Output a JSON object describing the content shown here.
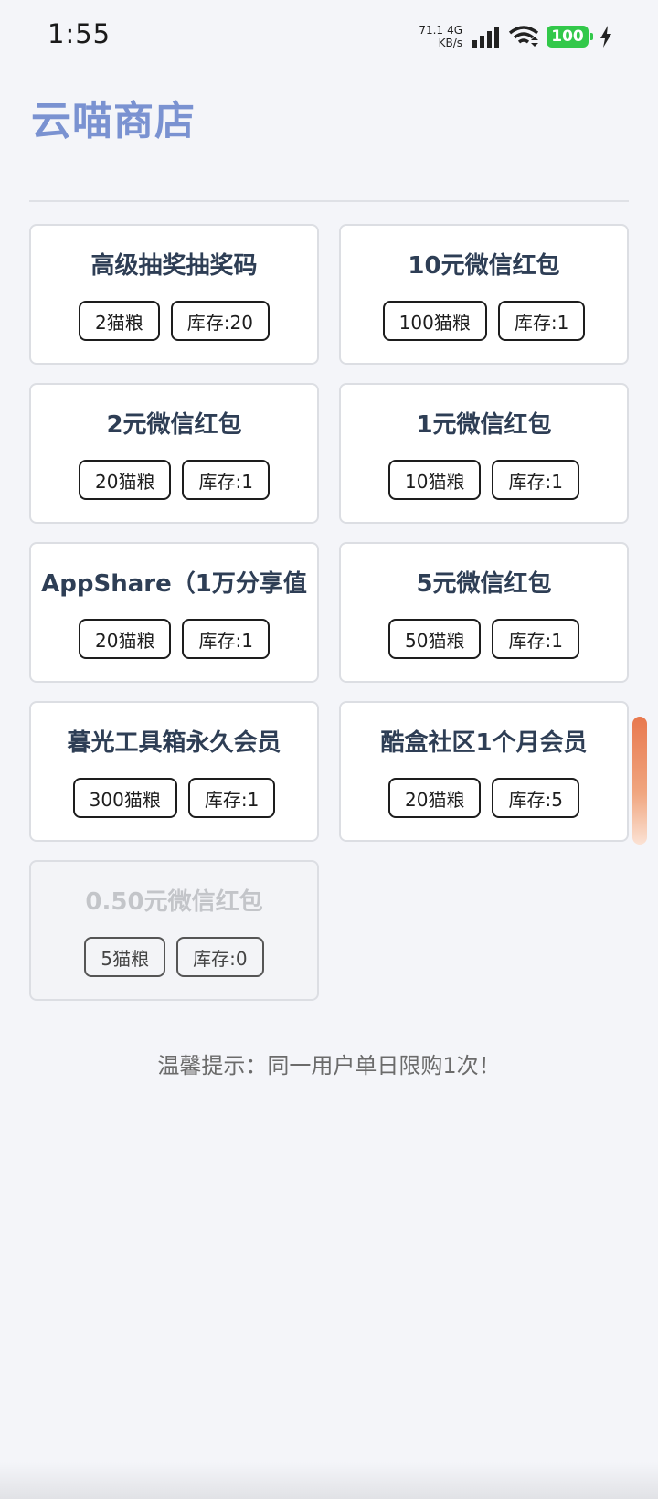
{
  "status_bar": {
    "time": "1:55",
    "net_speed_value": "71.1",
    "net_type": "4G",
    "net_speed_unit": "KB/s",
    "battery": "100",
    "icons": [
      "signal-icon",
      "wifi-icon",
      "battery-icon",
      "charging-icon"
    ]
  },
  "header": {
    "title": "云喵商店"
  },
  "items": [
    {
      "name": "高级抽奖抽奖码",
      "price": "2猫粮",
      "stock": "库存:20",
      "available": true
    },
    {
      "name": "10元微信红包",
      "price": "100猫粮",
      "stock": "库存:1",
      "available": true
    },
    {
      "name": "2元微信红包",
      "price": "20猫粮",
      "stock": "库存:1",
      "available": true
    },
    {
      "name": "1元微信红包",
      "price": "10猫粮",
      "stock": "库存:1",
      "available": true
    },
    {
      "name": "AppShare（1万分享值",
      "price": "20猫粮",
      "stock": "库存:1",
      "available": true
    },
    {
      "name": "5元微信红包",
      "price": "50猫粮",
      "stock": "库存:1",
      "available": true
    },
    {
      "name": "暮光工具箱永久会员",
      "price": "300猫粮",
      "stock": "库存:1",
      "available": true
    },
    {
      "name": "酷盒社区1个月会员",
      "price": "20猫粮",
      "stock": "库存:5",
      "available": true
    },
    {
      "name": "0.50元微信红包",
      "price": "5猫粮",
      "stock": "库存:0",
      "available": false
    }
  ],
  "tip": "温馨提示：同一用户单日限购1次！",
  "colors": {
    "title": "#7a92d1",
    "background": "#f4f5f9",
    "battery": "#32c84a",
    "scroll_thumb": "#e8784e"
  }
}
